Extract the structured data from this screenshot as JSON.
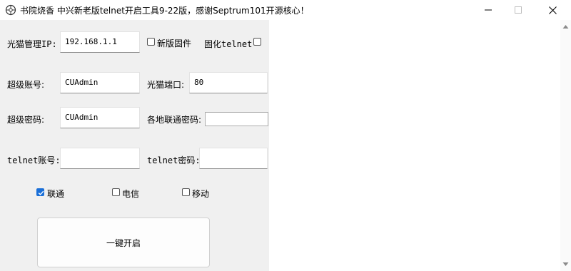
{
  "window": {
    "title": "书院烧香 中兴新老版telnet开启工具9-22版，感谢Septrum101开源核心！",
    "controls": {
      "minimize": "—",
      "maximize": "☐",
      "close": "✕"
    }
  },
  "form": {
    "ip_label": "光猫管理IP:",
    "ip_value": "192.168.1.1",
    "new_firmware_label": "新版固件",
    "new_firmware_checked": false,
    "solidify_telnet_label": "固化telnet",
    "solidify_telnet_checked": false,
    "super_account_label": "超级账号:",
    "super_account_value": "CUAdmin",
    "port_label": "光猫端口:",
    "port_value": "80",
    "super_password_label": "超级密码:",
    "super_password_value": "CUAdmin",
    "unicom_password_label": "各地联通密码:",
    "unicom_password_value": "",
    "telnet_account_label": "telnet账号:",
    "telnet_account_value": "",
    "telnet_password_label": "telnet密码:",
    "telnet_password_value": ""
  },
  "carriers": [
    {
      "label": "联通",
      "checked": true
    },
    {
      "label": "电信",
      "checked": false
    },
    {
      "label": "移动",
      "checked": false
    }
  ],
  "action_button": "一键开启",
  "log_output": "",
  "icons": [
    "app-icon",
    "minimize-icon",
    "maximize-icon",
    "close-icon",
    "chevron-down-icon",
    "check-icon",
    "scroll-up-icon",
    "scroll-down-icon"
  ],
  "colors": {
    "accent": "#1a6fd8",
    "background": "#f0f0f0"
  }
}
